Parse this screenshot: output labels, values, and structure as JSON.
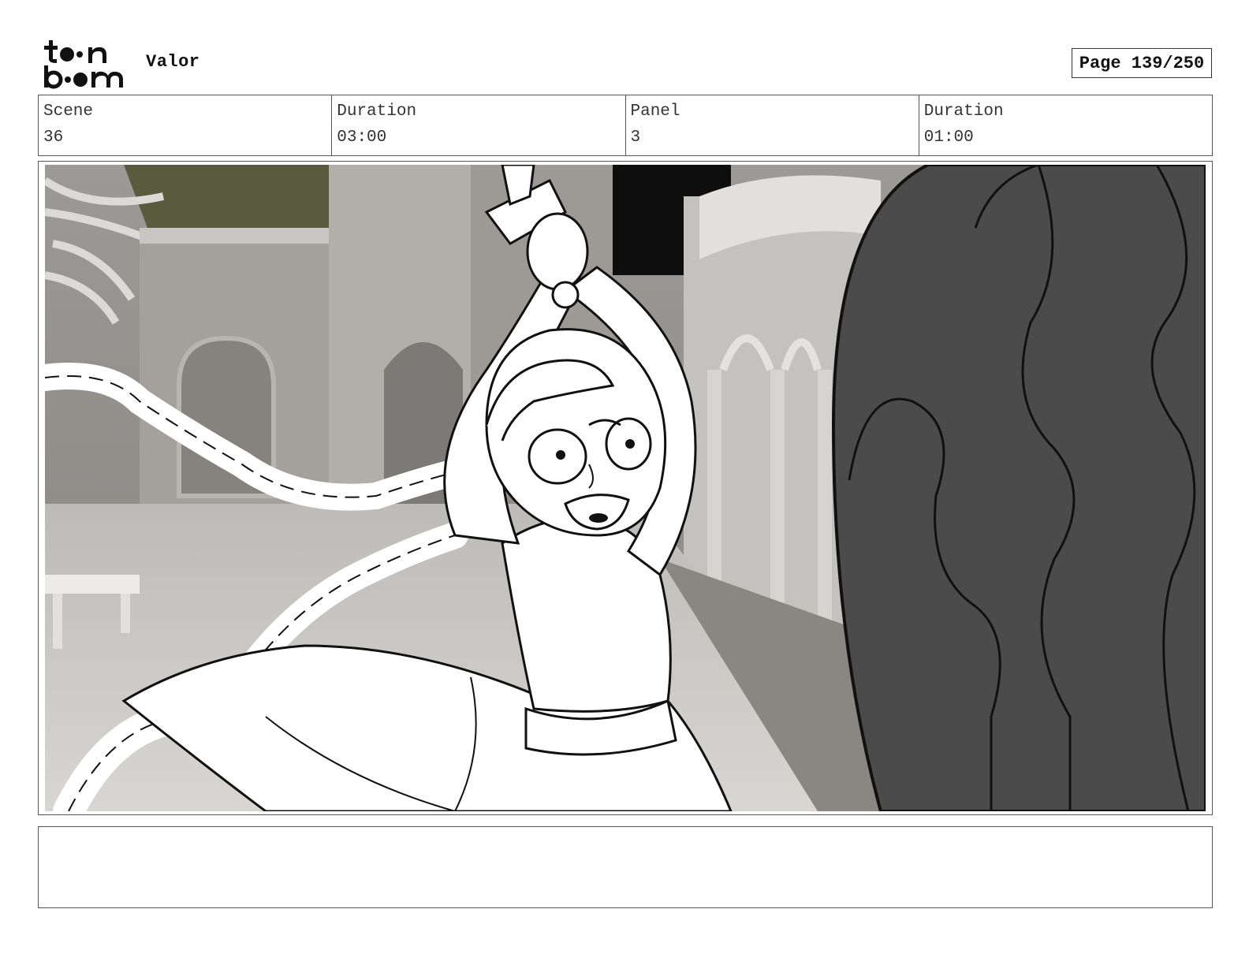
{
  "header": {
    "logo_text": "toon boom",
    "project_title": "Valor",
    "page_label": "Page 139/250"
  },
  "info": {
    "scene_label": "Scene",
    "scene_value": "36",
    "scene_duration_label": "Duration",
    "scene_duration_value": "03:00",
    "panel_label": "Panel",
    "panel_value": "3",
    "panel_duration_label": "Duration",
    "panel_duration_value": "01:00"
  },
  "notes": {
    "text": ""
  }
}
